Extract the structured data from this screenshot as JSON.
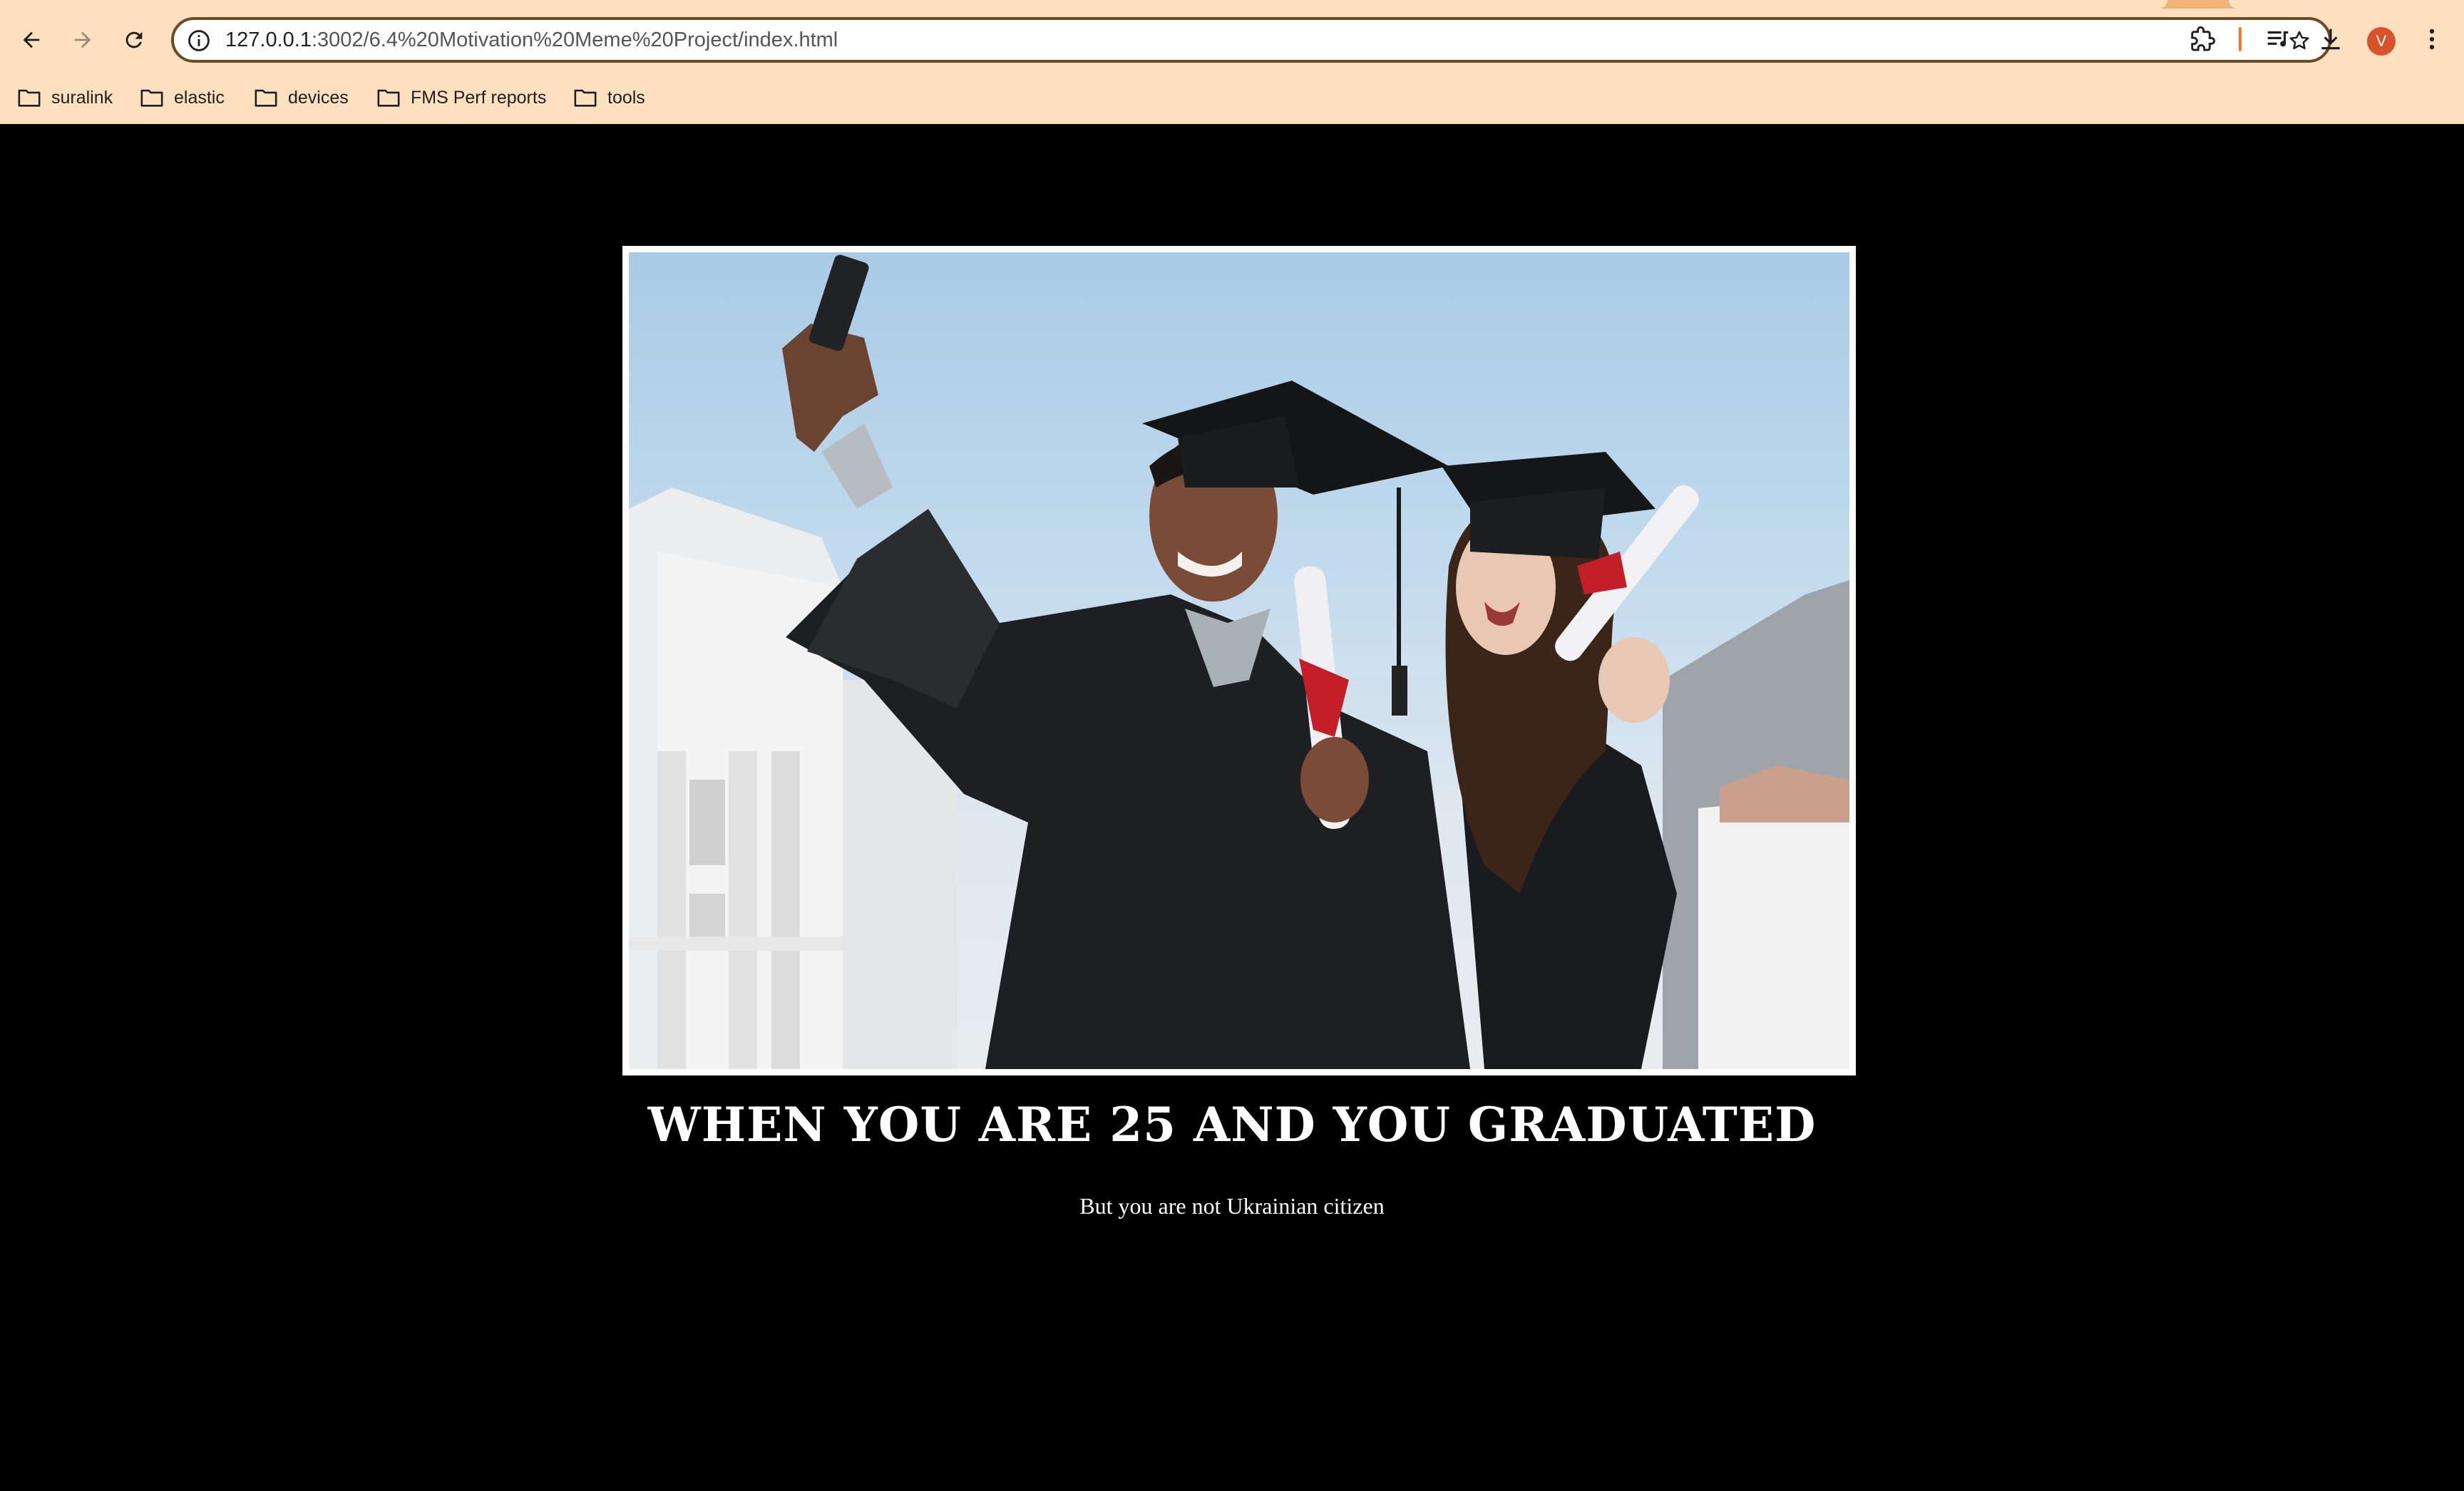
{
  "browser": {
    "url_host": "127.0.0.1",
    "url_path": ":3002/6.4%20Motivation%20Meme%20Project/index.html",
    "profile_initial": "V",
    "accent_color": "#f07a2a",
    "toolbar_color": "#fce0c0",
    "icons": [
      "back-arrow-icon",
      "forward-arrow-icon",
      "reload-icon",
      "site-info-icon",
      "bookmark-star-icon",
      "extensions-puzzle-icon",
      "media-controls-icon",
      "download-icon",
      "more-menu-icon"
    ]
  },
  "bookmarks": [
    {
      "label": "suralink"
    },
    {
      "label": "elastic"
    },
    {
      "label": "devices"
    },
    {
      "label": "FMS Perf reports"
    },
    {
      "label": "tools"
    }
  ],
  "meme": {
    "image_alt": "Two graduates in black caps and gowns taking a selfie",
    "headline": "WHEN YOU ARE 25 AND YOU GRADUATED",
    "subline": "But you are not Ukrainian citizen"
  }
}
